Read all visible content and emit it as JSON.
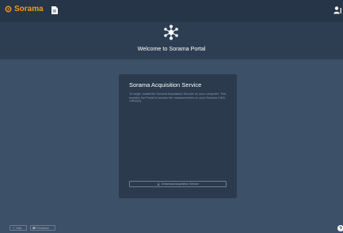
{
  "header": {
    "brand_name": "Sorama",
    "brand_color": "#f39a1e",
    "icons": [
      "sorama-logo-icon",
      "document-icon",
      "user-icon"
    ]
  },
  "hero": {
    "title": "Welcome to Sorama Portal"
  },
  "card": {
    "title": "Sorama Acquisition Service",
    "description": "To begin, install the Sorama Acquisition Service on your computer. This enables the Portal to access the measurements on your Sorama CAM-VIEW(S).",
    "download_label": "Download Acquisition Service"
  },
  "footer": {
    "help_label": "Help",
    "feedback_label": "Feedback"
  },
  "colors": {
    "background": "#3c5068",
    "topbar": "#263547",
    "card": "#2b3a4d",
    "accent": "#f39a1e"
  }
}
